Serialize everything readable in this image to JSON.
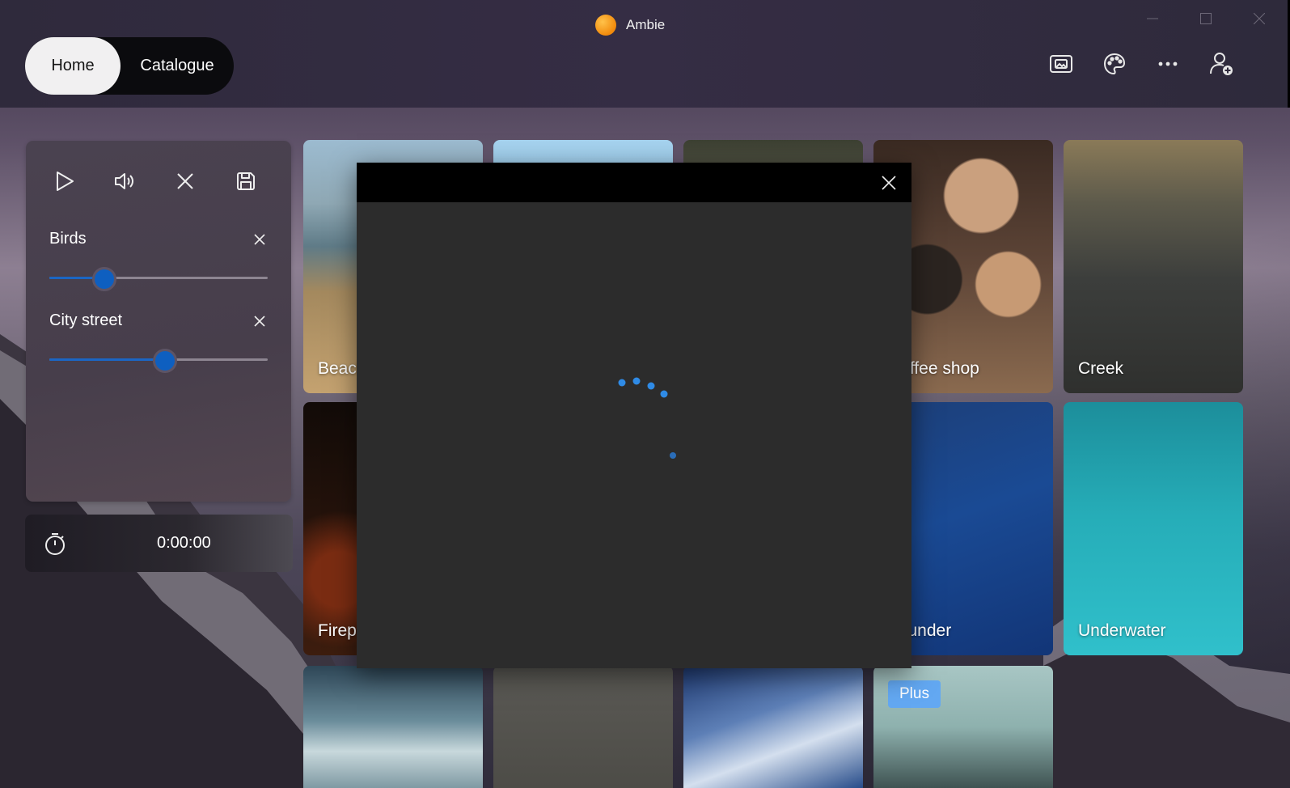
{
  "app": {
    "title": "Ambie"
  },
  "nav": {
    "tabs": [
      {
        "label": "Home",
        "active": true
      },
      {
        "label": "Catalogue",
        "active": false
      }
    ]
  },
  "top_actions": [
    "picture-icon",
    "palette-icon",
    "more-icon",
    "account-add-icon"
  ],
  "player": {
    "controls": [
      "play-icon",
      "volume-icon",
      "close-icon",
      "save-icon"
    ],
    "sounds": [
      {
        "name": "Birds",
        "volume": 0.25
      },
      {
        "name": "City street",
        "volume": 0.53
      }
    ]
  },
  "timer": {
    "value": "0:00:00"
  },
  "tiles": [
    {
      "label": "Beach"
    },
    {
      "label": ""
    },
    {
      "label": ""
    },
    {
      "label": "Coffee shop"
    },
    {
      "label": "Creek"
    },
    {
      "label": "Fireplace"
    },
    {
      "label": "Thunder"
    },
    {
      "label": "Underwater"
    },
    {
      "label": ""
    },
    {
      "label": ""
    },
    {
      "label": ""
    },
    {
      "label": "",
      "badge": "Plus"
    }
  ],
  "dialog": {
    "state": "loading"
  },
  "colors": {
    "accent": "#0e5fc0",
    "spinner": "#2f8be6",
    "plus_badge": "#63a8f2"
  }
}
